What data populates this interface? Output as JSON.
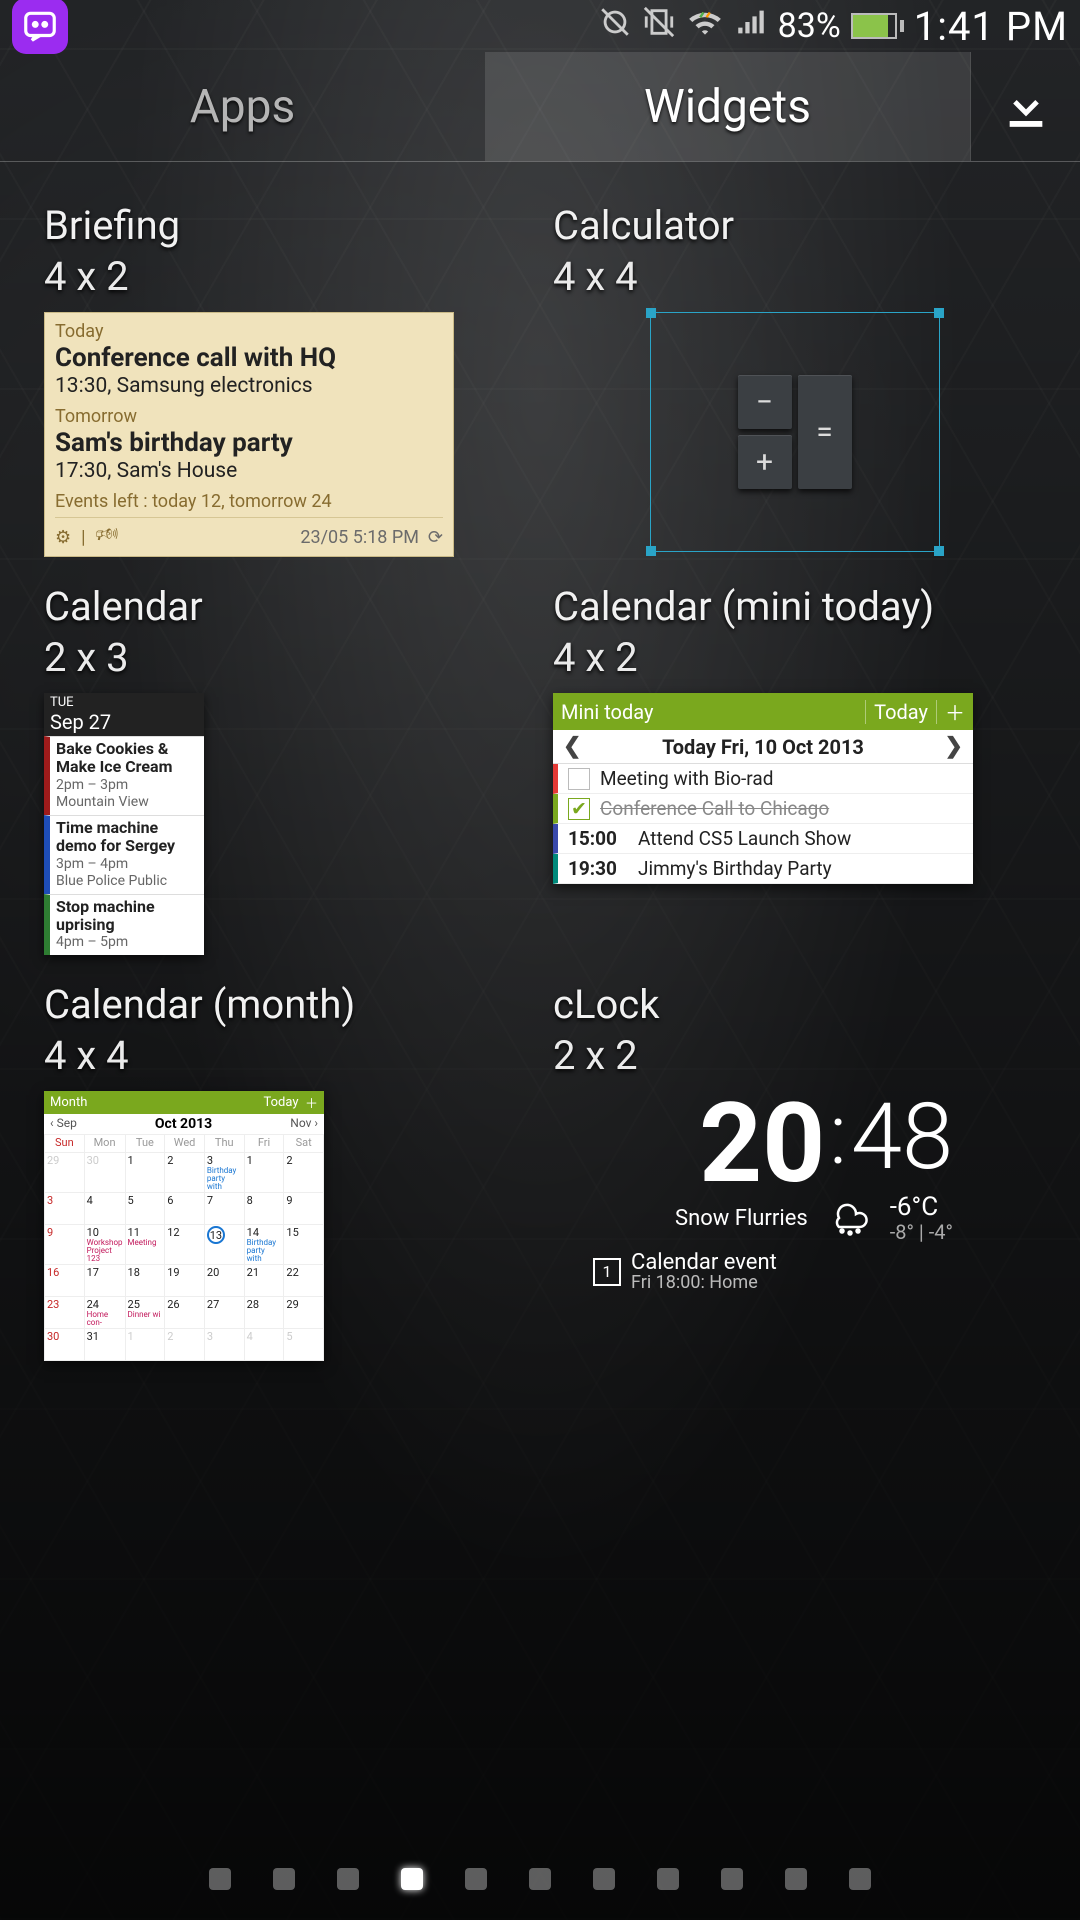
{
  "status": {
    "battery_pct": "83%",
    "time": "1:41 PM"
  },
  "tabs": {
    "apps": "Apps",
    "widgets": "Widgets"
  },
  "widgets": {
    "briefing": {
      "title": "Briefing",
      "size": "4 x 2",
      "today_label": "Today",
      "event1_title": "Conference call with HQ",
      "event1_sub": "13:30, Samsung electronics",
      "tomorrow_label": "Tomorrow",
      "event2_title": "Sam's birthday party",
      "event2_sub": "17:30, Sam's House",
      "events_left": "Events left : today 12, tomorrow 24",
      "timestamp": "23/05 5:18 PM"
    },
    "calculator": {
      "title": "Calculator",
      "size": "4 x 4",
      "minus": "−",
      "plus": "+",
      "equals": "="
    },
    "calendar23": {
      "title": "Calendar",
      "size": "2 x 3",
      "dow": "TUE",
      "date": "Sep 27",
      "e1_t": "Bake Cookies & Make Ice Cream",
      "e1_time": "2pm – 3pm",
      "e1_loc": "Mountain View",
      "e2_t": "Time machine demo for Sergey",
      "e2_time": "3pm – 4pm",
      "e2_loc": "Blue Police Public",
      "e3_t": "Stop machine uprising",
      "e3_time": "4pm – 5pm"
    },
    "mini": {
      "title": "Calendar (mini today)",
      "size": "4 x 2",
      "bar_title": "Mini today",
      "bar_today": "Today",
      "date_line": "Today  Fri, 10 Oct  2013",
      "l1": "Meeting with Bio-rad",
      "l2": "Conference Call to Chicago",
      "l3_time": "15:00",
      "l3_text": "Attend  CS5 Launch Show",
      "l4_time": "19:30",
      "l4_text": "Jimmy's Birthday Party"
    },
    "month": {
      "title": "Calendar (month)",
      "size": "4 x 4",
      "bar_title": "Month",
      "bar_today": "Today",
      "prev": "‹ Sep",
      "cur": "Oct  2013",
      "next": "Nov ›",
      "dows": [
        "Sun",
        "Mon",
        "Tue",
        "Wed",
        "Thu",
        "Fri",
        "Sat"
      ]
    },
    "clock": {
      "title": "cLock",
      "size": "2 x 2",
      "h": "20",
      "m": "48",
      "weather": "Snow Flurries",
      "temp": "-6°C",
      "hilo": "-8° | -4°",
      "cal_title": "Calendar event",
      "cal_sub": "Fri 18:00: Home"
    }
  },
  "pager": {
    "count": 11,
    "active": 3
  }
}
